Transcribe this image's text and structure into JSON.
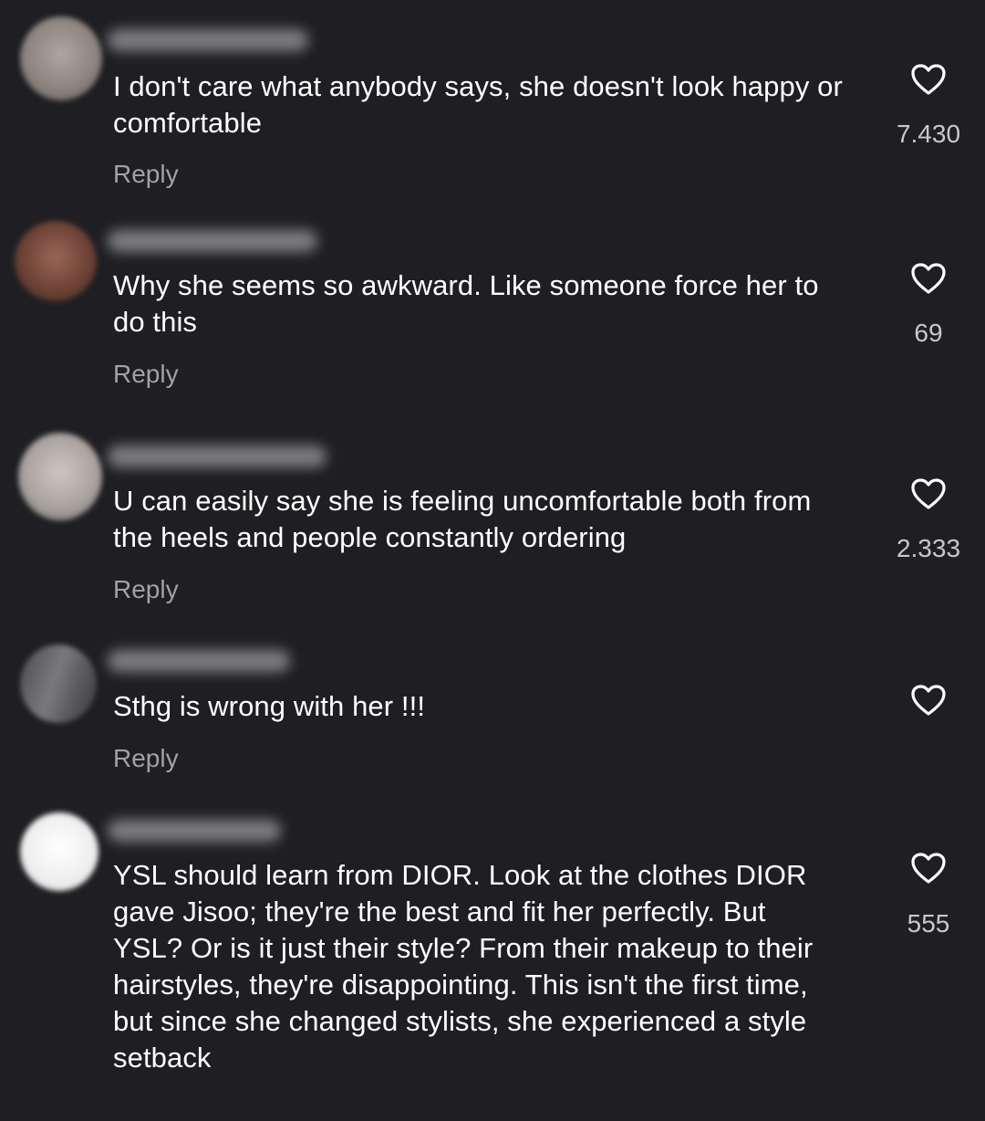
{
  "comments": [
    {
      "text": "I don't care what anybody says, she doesn't look happy or comfortable",
      "reply_label": "Reply",
      "likes": "7.430",
      "like_icon": "heart-outline-icon",
      "avatar_color": "#9a8f8a"
    },
    {
      "text": "Why she seems so awkward. Like someone force her to do this",
      "reply_label": "Reply",
      "likes": "69",
      "like_icon": "heart-outline-icon",
      "avatar_color": "#7a4a3e"
    },
    {
      "text": "U can easily say she is feeling uncomfortable both from the heels and people constantly ordering",
      "reply_label": "Reply",
      "likes": "2.333",
      "like_icon": "heart-outline-icon",
      "avatar_color": "#b9b3ae"
    },
    {
      "text": "Sthg is wrong with her !!!",
      "reply_label": "Reply",
      "likes": "",
      "like_icon": "heart-outline-icon",
      "avatar_color": "#6c6c70"
    },
    {
      "text": "YSL should learn from DIOR. Look at the clothes DIOR gave Jisoo; they're the best and fit her perfectly. But YSL? Or is it just their style? From their makeup to their hairstyles, they're disappointing. This isn't the first time, but since she changed stylists, she experienced a style setback",
      "reply_label": "",
      "likes": "555",
      "like_icon": "heart-outline-icon",
      "avatar_color": "#e9e9e9"
    }
  ],
  "colors": {
    "background": "#1f1f23",
    "text": "#ffffff",
    "secondary_text": "#a1a1a6",
    "like_count": "#c8c8cc"
  }
}
